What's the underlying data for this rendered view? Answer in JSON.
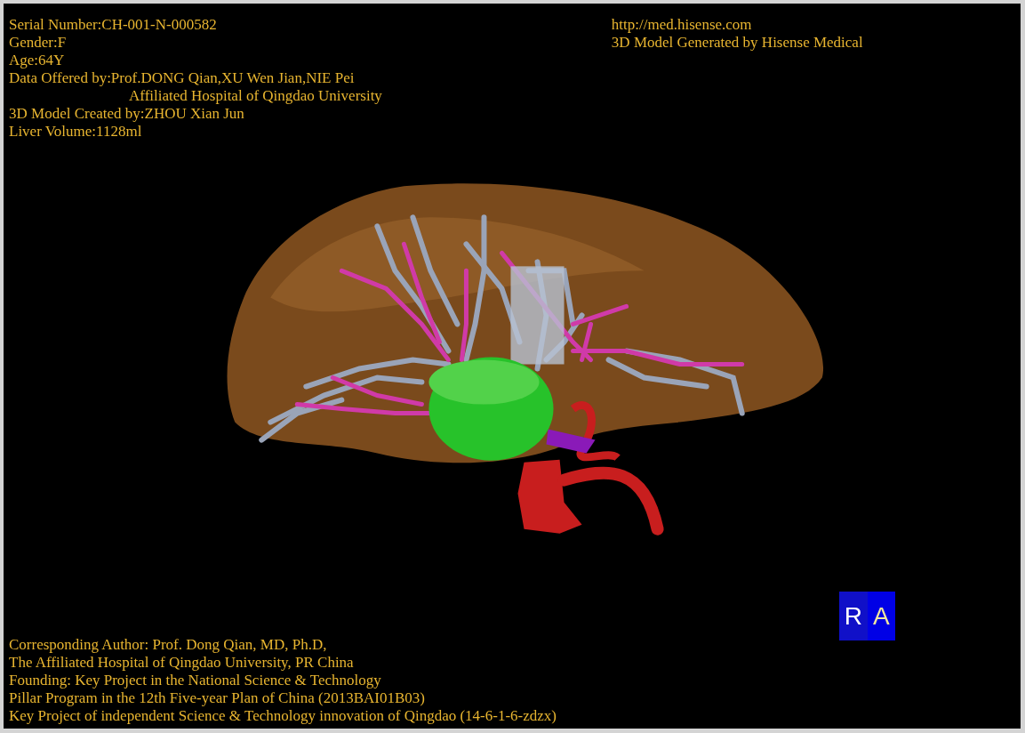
{
  "info_left": [
    {
      "text": "Serial Number:CH-001-N-000582",
      "kind": "line"
    },
    {
      "text": "Gender:F",
      "kind": "line"
    },
    {
      "text": "Age:64Y",
      "kind": "line"
    },
    {
      "text": "Data Offered by:Prof.DONG Qian,XU Wen Jian,NIE Pei",
      "kind": "line"
    },
    {
      "text": "Affiliated Hospital of Qingdao University",
      "kind": "indent"
    },
    {
      "text": "3D Model Created by:ZHOU Xian Jun",
      "kind": "line"
    },
    {
      "text": "Liver Volume:1128ml",
      "kind": "line"
    }
  ],
  "info_right": [
    {
      "text": "http://med.hisense.com",
      "kind": "line"
    },
    {
      "text": "3D Model Generated by Hisense Medical",
      "kind": "line"
    }
  ],
  "footer": [
    {
      "text": "Corresponding Author: Prof. Dong Qian, MD, Ph.D,",
      "kind": "line"
    },
    {
      "text": "The Affiliated Hospital of Qingdao University, PR China",
      "kind": "line"
    },
    {
      "text": "Founding: Key Project in the National Science & Technology",
      "kind": "line"
    },
    {
      "text": "Pillar Program in the 12th Five-year Plan of China (2013BAI01B03)",
      "kind": "line"
    },
    {
      "text": "Key Project of independent Science & Technology innovation of Qingdao (14-6-1-6-zdzx)",
      "kind": "line"
    }
  ],
  "orientation_cube": {
    "faces": [
      "R",
      "A"
    ]
  }
}
